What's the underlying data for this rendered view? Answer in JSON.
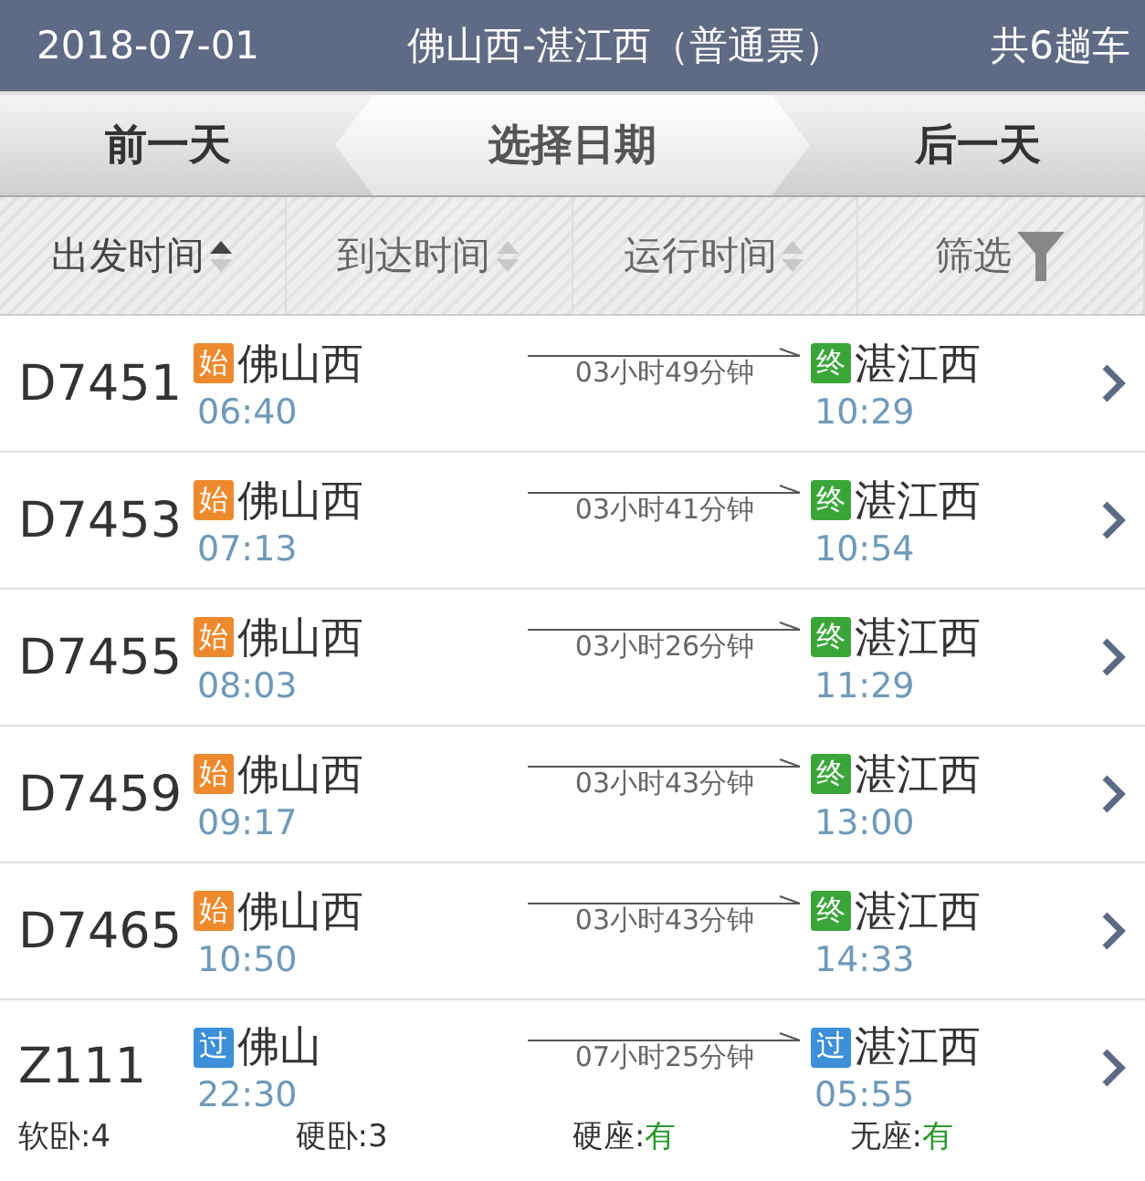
{
  "header": {
    "date": "2018-07-01",
    "route": "佛山西-湛江西（普通票）",
    "count": "共6趟车"
  },
  "date_nav": {
    "prev": "前一天",
    "pick": "选择日期",
    "next": "后一天"
  },
  "sort_bar": [
    {
      "label": "出发时间",
      "kind": "sort",
      "selected": true
    },
    {
      "label": "到达时间",
      "kind": "sort",
      "selected": false
    },
    {
      "label": "运行时间",
      "kind": "sort",
      "selected": false
    },
    {
      "label": "筛选",
      "kind": "filter",
      "selected": false
    }
  ],
  "trains": [
    {
      "number": "D7451",
      "from": {
        "badge": "始",
        "kind": "start",
        "station": "佛山西",
        "time": "06:40"
      },
      "duration": "03小时49分钟",
      "to": {
        "badge": "终",
        "kind": "end",
        "station": "湛江西",
        "time": "10:29"
      }
    },
    {
      "number": "D7453",
      "from": {
        "badge": "始",
        "kind": "start",
        "station": "佛山西",
        "time": "07:13"
      },
      "duration": "03小时41分钟",
      "to": {
        "badge": "终",
        "kind": "end",
        "station": "湛江西",
        "time": "10:54"
      }
    },
    {
      "number": "D7455",
      "from": {
        "badge": "始",
        "kind": "start",
        "station": "佛山西",
        "time": "08:03"
      },
      "duration": "03小时26分钟",
      "to": {
        "badge": "终",
        "kind": "end",
        "station": "湛江西",
        "time": "11:29"
      }
    },
    {
      "number": "D7459",
      "from": {
        "badge": "始",
        "kind": "start",
        "station": "佛山西",
        "time": "09:17"
      },
      "duration": "03小时43分钟",
      "to": {
        "badge": "终",
        "kind": "end",
        "station": "湛江西",
        "time": "13:00"
      }
    },
    {
      "number": "D7465",
      "from": {
        "badge": "始",
        "kind": "start",
        "station": "佛山西",
        "time": "10:50"
      },
      "duration": "03小时43分钟",
      "to": {
        "badge": "终",
        "kind": "end",
        "station": "湛江西",
        "time": "14:33"
      }
    },
    {
      "number": "Z111",
      "from": {
        "badge": "过",
        "kind": "pass",
        "station": "佛山",
        "time": "22:30"
      },
      "duration": "07小时25分钟",
      "to": {
        "badge": "过",
        "kind": "pass",
        "station": "湛江西",
        "time": "05:55"
      },
      "seats": [
        {
          "label": "软卧:",
          "value": "4",
          "kind": "count"
        },
        {
          "label": "硬卧:",
          "value": "3",
          "kind": "count"
        },
        {
          "label": "硬座:",
          "value": "有",
          "kind": "available"
        },
        {
          "label": "无座:",
          "value": "有",
          "kind": "available"
        }
      ]
    }
  ]
}
